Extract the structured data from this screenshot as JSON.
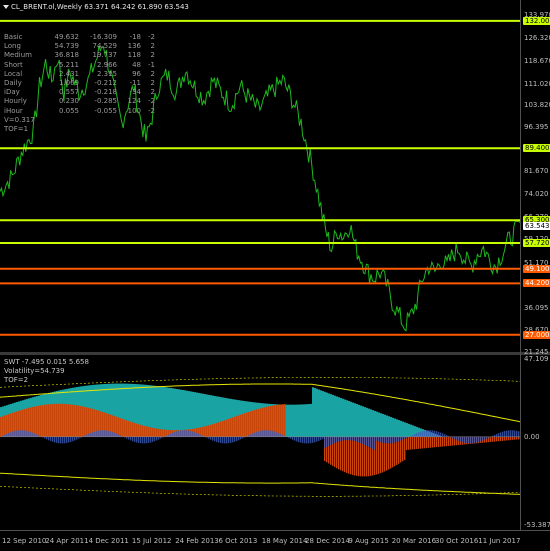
{
  "symbol_title": "CL_BRENT.ol,Weekly  63.371 64.242 61.890 63.543",
  "stats": [
    {
      "label": "Basic",
      "v1": "49.632",
      "v2": "-16.309",
      "v3": "-18",
      "v4": "-2"
    },
    {
      "label": "Long",
      "v1": "54.739",
      "v2": "74.529",
      "v3": "136",
      "v4": "2"
    },
    {
      "label": "Medium",
      "v1": "36.818",
      "v2": "19.737",
      "v3": "118",
      "v4": "2"
    },
    {
      "label": "Short",
      "v1": "5.211",
      "v2": "2.966",
      "v3": "48",
      "v4": "-1"
    },
    {
      "label": "Local",
      "v1": "2.431",
      "v2": "2.315",
      "v3": "96",
      "v4": "2"
    },
    {
      "label": "Daily",
      "v1": "1.069",
      "v2": "-0.212",
      "v3": "-11",
      "v4": "2"
    },
    {
      "label": "iDay",
      "v1": "0.557",
      "v2": "-0.218",
      "v3": "-34",
      "v4": "2"
    },
    {
      "label": "Hourly",
      "v1": "0.230",
      "v2": "-0.285",
      "v3": "124",
      "v4": "-2"
    },
    {
      "label": "iHour",
      "v1": "0.055",
      "v2": "-0.055",
      "v3": "100",
      "v4": "-2"
    },
    {
      "label": "V=0.317",
      "v1": "",
      "v2": "",
      "v3": "",
      "v4": ""
    },
    {
      "label": "TOF=1",
      "v1": "",
      "v2": "",
      "v3": "",
      "v4": ""
    }
  ],
  "price_axis": [
    "133.970",
    "126.320",
    "118.670",
    "111.020",
    "103.820",
    "96.395",
    "89.400",
    "81.670",
    "74.020",
    "66.370",
    "59.120",
    "51.170",
    "43.820",
    "36.095",
    "28.670",
    "21.245"
  ],
  "levels": [
    {
      "price": "132.000",
      "color": "lime"
    },
    {
      "price": "89.400",
      "color": "lime"
    },
    {
      "price": "65.300",
      "color": "lime"
    },
    {
      "price": "57.720",
      "color": "lime"
    },
    {
      "price": "49.100",
      "color": "orange"
    },
    {
      "price": "44.200",
      "color": "orange"
    },
    {
      "price": "27.000",
      "color": "orange"
    }
  ],
  "current_price": "63.543",
  "sub_header": {
    "line1": "SWT -7.495 0.015 5.658",
    "line2": "Volatility=54.739",
    "line3": "TOF=2"
  },
  "sub_axis": [
    "47.109",
    "0.00",
    "-53.387"
  ],
  "time_axis": [
    "12 Sep 2010",
    "24 Apr 2011",
    "4 Dec 2011",
    "15 Jul 2012",
    "24 Feb 2013",
    "6 Oct 2013",
    "18 May 2014",
    "28 Dec 2014",
    "9 Aug 2015",
    "20 Mar 2016",
    "30 Oct 2016",
    "11 Jun 2017"
  ],
  "colors": {
    "price_line": "#1db91d",
    "level_lime": "#c8ff00",
    "level_orange": "#ff5a00",
    "teal": "#1aa3a3",
    "rust": "#c8460a",
    "blue": "#3c5ab4",
    "yellow": "#e6e600"
  }
}
